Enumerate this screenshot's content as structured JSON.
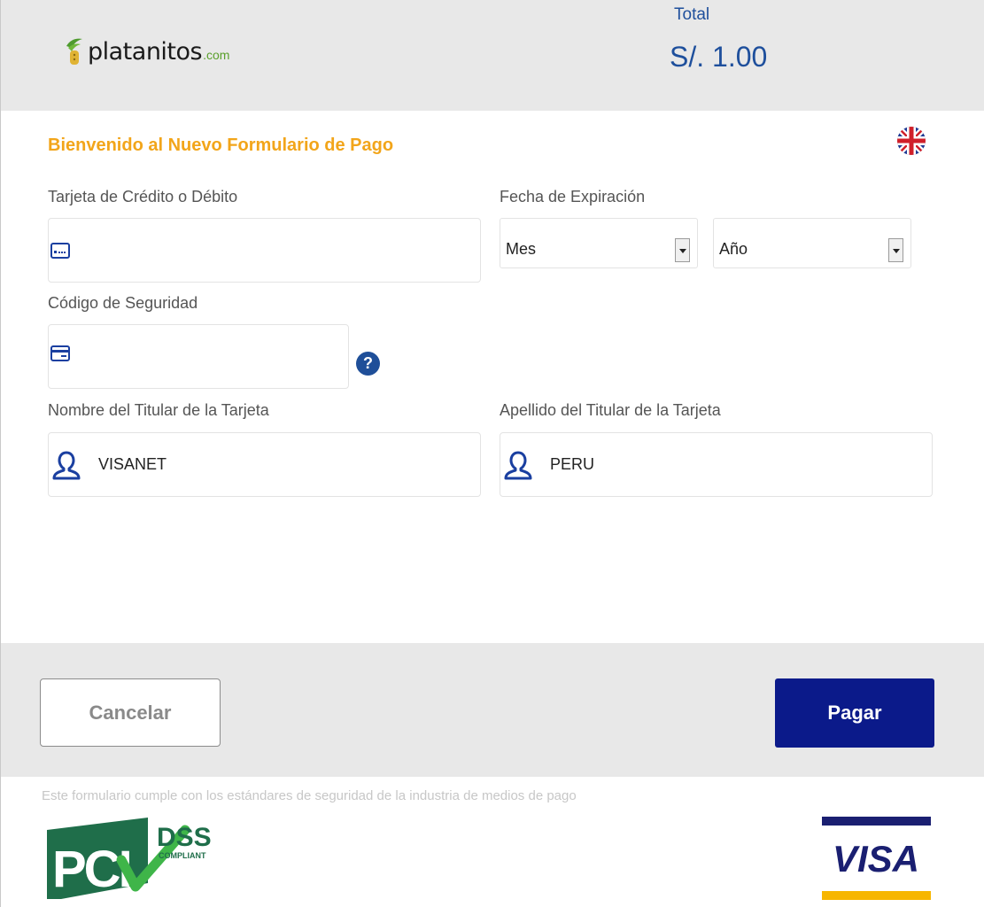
{
  "header": {
    "logo_text": "platanitos",
    "logo_tld": ".com",
    "total_label": "Total",
    "total_amount": "S/. 1.00"
  },
  "form": {
    "welcome": "Bienvenido al Nuevo Formulario de Pago",
    "card_number": {
      "label": "Tarjeta de Crédito o Débito",
      "value": ""
    },
    "expiration": {
      "label": "Fecha de Expiración",
      "month": "Mes",
      "year": "Año"
    },
    "security_code": {
      "label": "Código de Seguridad",
      "value": "",
      "help": "?"
    },
    "first_name": {
      "label": "Nombre del Titular de la Tarjeta",
      "value": "VISANET"
    },
    "last_name": {
      "label": "Apellido del Titular de la Tarjeta",
      "value": "PERU"
    }
  },
  "actions": {
    "cancel_label": "Cancelar",
    "pay_label": "Pagar"
  },
  "footer": {
    "disclaimer": "Este formulario cumple con los estándares de seguridad de la industria de medios de pago",
    "pci_text": "PCI",
    "dss_text": "DSS",
    "compliant_text": "COMPLIANT",
    "visa_text": "VISA"
  },
  "colors": {
    "accent_orange": "#f2a51a",
    "brand_blue": "#1e4f9c",
    "pay_button": "#0b1a8a",
    "icon_blue": "#1a3fa0"
  },
  "icons": [
    "language-flag-icon",
    "card-number-icon",
    "security-card-icon",
    "help-icon",
    "user-icon"
  ]
}
